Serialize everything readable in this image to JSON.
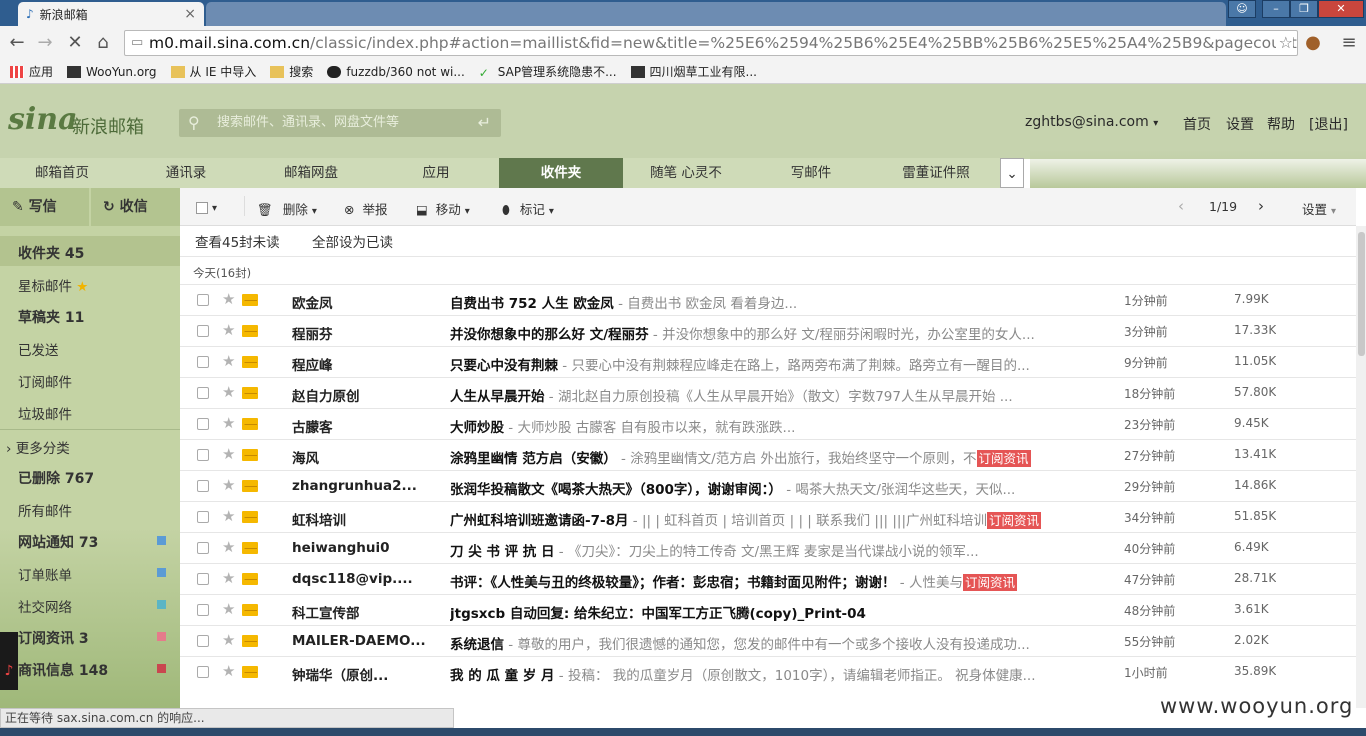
{
  "browser": {
    "active_tab_title": "新浪邮箱",
    "close_glyph": "×",
    "url_host": "m0.mail.sina.com.cn",
    "url_path": "/classic/index.php#action=maillist&fid=new&title=%25E6%2594%25B6%25E4%25BB%25B6%25E5%25A4%25B9&pagecount=",
    "bookmarks": [
      "应用",
      "WooYun.org",
      "从 IE 中导入",
      "搜索",
      "fuzzdb/360 not wi...",
      "SAP管理系统隐患不...",
      "四川烟草工业有限..."
    ]
  },
  "header": {
    "logo_text": "新浪邮箱",
    "search_placeholder": "搜索邮件、通讯录、网盘文件等",
    "account": "zghtbs@sina.com",
    "links": [
      "首页",
      "设置",
      "帮助",
      "[退出]"
    ]
  },
  "nav": {
    "tabs": [
      "邮箱首页",
      "通讯录",
      "邮箱网盘",
      "应用",
      "收件夹",
      "随笔 心灵不",
      "写邮件",
      "雷董证件照"
    ],
    "active_index": 4
  },
  "sidebar": {
    "write": "写信",
    "receive": "收信",
    "inbox": "收件夹 45",
    "items": [
      "星标邮件",
      "草稿夹 11",
      "已发送",
      "订阅邮件",
      "垃圾邮件",
      "更多分类",
      "已删除 767",
      "所有邮件",
      "网站通知 73",
      "订单账单",
      "社交网络",
      "订阅资讯 3",
      "商讯信息 148"
    ]
  },
  "toolbar": {
    "delete": "删除",
    "report": "举报",
    "move": "移动",
    "mark": "标记",
    "page": "1/19",
    "settings": "设置"
  },
  "subbar": {
    "view_unread": "查看45封未读",
    "mark_all_read": "全部设为已读",
    "group_today": "今天(16封)"
  },
  "emails": [
    {
      "from": "欧金凤",
      "subject": "自费出书 752 人生 欧金凤",
      "preview": " - 自费出书                                    欧金凤       看着身边...",
      "badge": "",
      "time": "1分钟前",
      "size": "7.99K"
    },
    {
      "from": "程丽芬",
      "subject": "并没你想象中的那么好 文/程丽芬",
      "preview": " - 并没你想象中的那么好 文/程丽芬闲暇时光，办公室里的女人...",
      "badge": "",
      "time": "3分钟前",
      "size": "17.33K"
    },
    {
      "from": "程应峰",
      "subject": "只要心中没有荆棘",
      "preview": " - 只要心中没有荆棘程应峰走在路上，路两旁布满了荆棘。路旁立有一醒目的...",
      "badge": "",
      "time": "9分钟前",
      "size": "11.05K"
    },
    {
      "from": "赵自力原创",
      "subject": "人生从早晨开始",
      "preview": " - 湖北赵自力原创投稿《人生从早晨开始》（散文）字数797人生从早晨开始   ...",
      "badge": "",
      "time": "18分钟前",
      "size": "57.80K"
    },
    {
      "from": "古朦客",
      "subject": "大师炒股",
      "preview": " - 大师炒股                              古朦客      自有股市以来，就有跌涨跌...",
      "badge": "",
      "time": "23分钟前",
      "size": "9.45K"
    },
    {
      "from": "海风",
      "subject": "涂鸦里幽情 范方启（安徽）",
      "preview": " - 涂鸦里幽情文/范方启 外出旅行，我始终坚守一个原则，不",
      "badge": "订阅资讯",
      "time": "27分钟前",
      "size": "13.41K"
    },
    {
      "from": "zhangrunhua2...",
      "subject": "张润华投稿散文《喝茶大热天》（800字），谢谢审阅：）",
      "preview": " - 喝茶大热天文/张润华这些天，天似...",
      "badge": "",
      "time": "29分钟前",
      "size": "14.86K"
    },
    {
      "from": "虹科培训",
      "subject": "广州虹科培训班邀请函-7-8月",
      "preview": " - || | 虹科首页 | 培训首页 | | | 联系我们 ||| |||广州虹科培训",
      "badge": "订阅资讯",
      "time": "34分钟前",
      "size": "51.85K"
    },
    {
      "from": "heiwanghui0",
      "subject": "刀 尖 书 评 抗 日",
      "preview": " - 《刀尖》：刀尖上的特工传奇      文/黑王辉      麦家是当代谍战小说的领军...",
      "badge": "",
      "time": "40分钟前",
      "size": "6.49K"
    },
    {
      "from": "dqsc118@vip....",
      "subject": "书评：《人性美与丑的终极较量》；作者：彭忠宿；书籍封面见附件；谢谢！",
      "preview": " - 人性美与",
      "badge": "订阅资讯",
      "time": "47分钟前",
      "size": "28.71K"
    },
    {
      "from": "科工宣传部",
      "subject": "jtgsxcb 自动回复: 给朱纪立：中国军工方正飞腾(copy)_Print-04",
      "preview": "",
      "badge": "",
      "time": "48分钟前",
      "size": "3.61K"
    },
    {
      "from": "MAILER-DAEMO...",
      "subject": "系统退信",
      "preview": " - 尊敬的用户，我们很遗憾的通知您，您发的邮件中有一个或多个接收人没有投递成功...",
      "badge": "",
      "time": "55分钟前",
      "size": "2.02K"
    },
    {
      "from": "钟瑞华（原创...",
      "subject": "我 的 瓜 童 岁 月",
      "preview": " - 投稿： 我的瓜童岁月（原创散文，1010字），请编辑老师指正。 祝身体健康...",
      "badge": "",
      "time": "1小时前",
      "size": "35.89K"
    }
  ],
  "status_text": "正在等待 sax.sina.com.cn 的响应...",
  "watermark": "www.wooyun.org",
  "colors": {
    "header_bg": "#c6d3ae",
    "nav_active": "#60784d",
    "badge": "#e55555",
    "sidebar": "#c4d3a4"
  }
}
